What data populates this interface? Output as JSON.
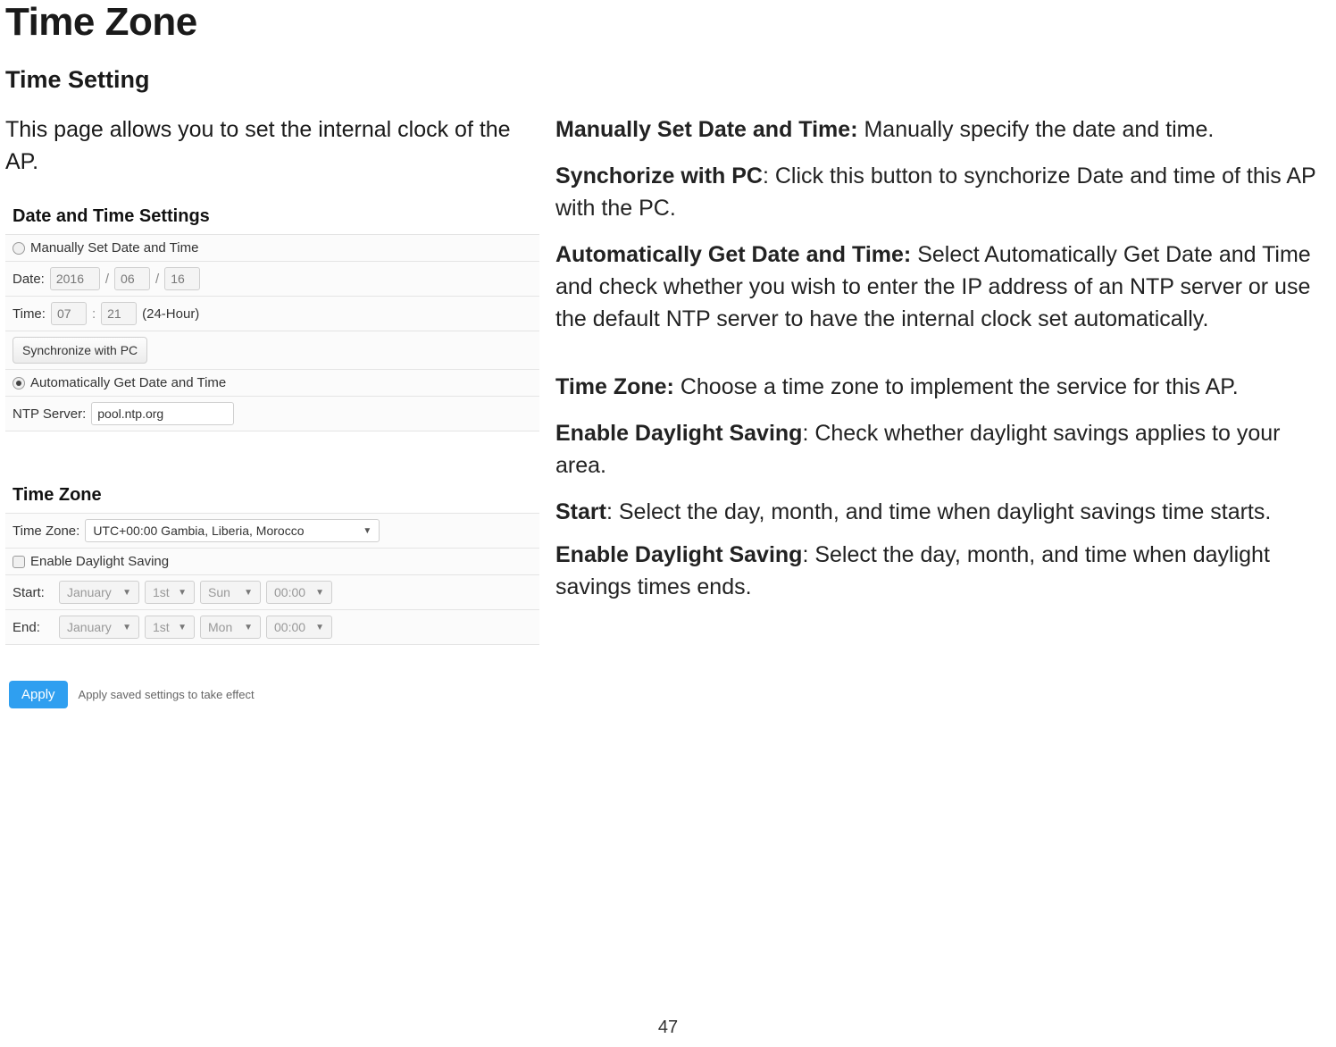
{
  "title": "Time Zone",
  "subtitle": "Time Setting",
  "intro": "This page allows you to set the internal clock of the AP.",
  "screenshot": {
    "dt": {
      "heading": "Date and Time Settings",
      "manual_label": "Manually Set Date and Time",
      "date_label": "Date:",
      "year": "2016",
      "month": "06",
      "day": "16",
      "slash": "/",
      "time_label": "Time:",
      "hour": "07",
      "minute": "21",
      "colon": ":",
      "hour_note": "(24-Hour)",
      "sync_btn": "Synchronize with PC",
      "auto_label": "Automatically Get Date and Time",
      "ntp_label": "NTP Server:",
      "ntp_value": "pool.ntp.org"
    },
    "tz": {
      "heading": "Time Zone",
      "tz_label": "Time Zone:",
      "tz_value": "UTC+00:00 Gambia, Liberia, Morocco",
      "dls_label": "Enable Daylight Saving",
      "start_label": "Start:",
      "end_label": "End:",
      "start": {
        "month": "January",
        "week": "1st",
        "day": "Sun",
        "time": "00:00"
      },
      "end": {
        "month": "January",
        "week": "1st",
        "day": "Mon",
        "time": "00:00"
      }
    },
    "apply": {
      "btn": "Apply",
      "note": "Apply saved settings to take effect"
    }
  },
  "desc": {
    "p1_b": "Manually Set Date and Time: ",
    "p1": "Manually specify the date and time.",
    "p2_b": "Synchorize with PC",
    "p2": ": Click this button to synchorize Date and time of this AP with the PC.",
    "p3_b": "Automatically Get Date and Time: ",
    "p3": "Select Automatically Get Date and Time and check whether you wish to enter the IP address of an NTP server or use the default NTP server to have the internal clock set automatically.",
    "p4_b": "Time Zone: ",
    "p4": "Choose a time zone to implement the service for this AP.",
    "p5_b": "Enable Daylight Saving",
    "p5": ": Check whether daylight savings applies to your area.",
    "p6_b": "Start",
    "p6": ": Select the day, month, and time when daylight savings time starts.",
    "p7_b": "Enable Daylight Saving",
    "p7": ": Select the day, month, and time when daylight savings times ends."
  },
  "page_number": "47"
}
